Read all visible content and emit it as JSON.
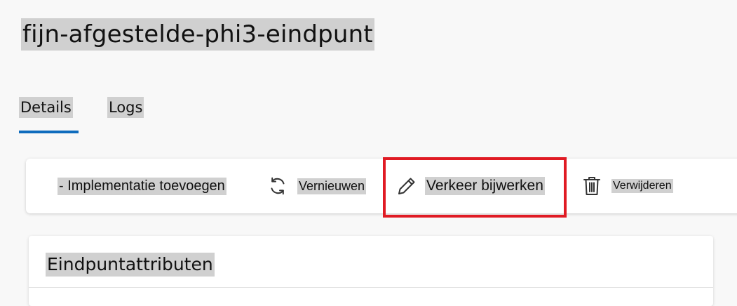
{
  "page": {
    "title": "fijn-afgestelde-phi3-eindpunt"
  },
  "tabs": [
    {
      "label": "Details",
      "selected": true
    },
    {
      "label": "Logs",
      "selected": false
    }
  ],
  "toolbar": {
    "add_label": "- Implementatie toevoegen",
    "refresh_label": "Vernieuwen",
    "update_traffic_label": "Verkeer bijwerken",
    "delete_label": "Verwijderen"
  },
  "card": {
    "title": "Eindpuntattributen"
  },
  "colors": {
    "accent": "#0f6cbd",
    "highlight_box": "#e01b24",
    "text_highlight": "#d0d0d0"
  },
  "icons": {
    "refresh": "refresh-icon",
    "edit": "pencil-icon",
    "delete": "trash-icon"
  }
}
